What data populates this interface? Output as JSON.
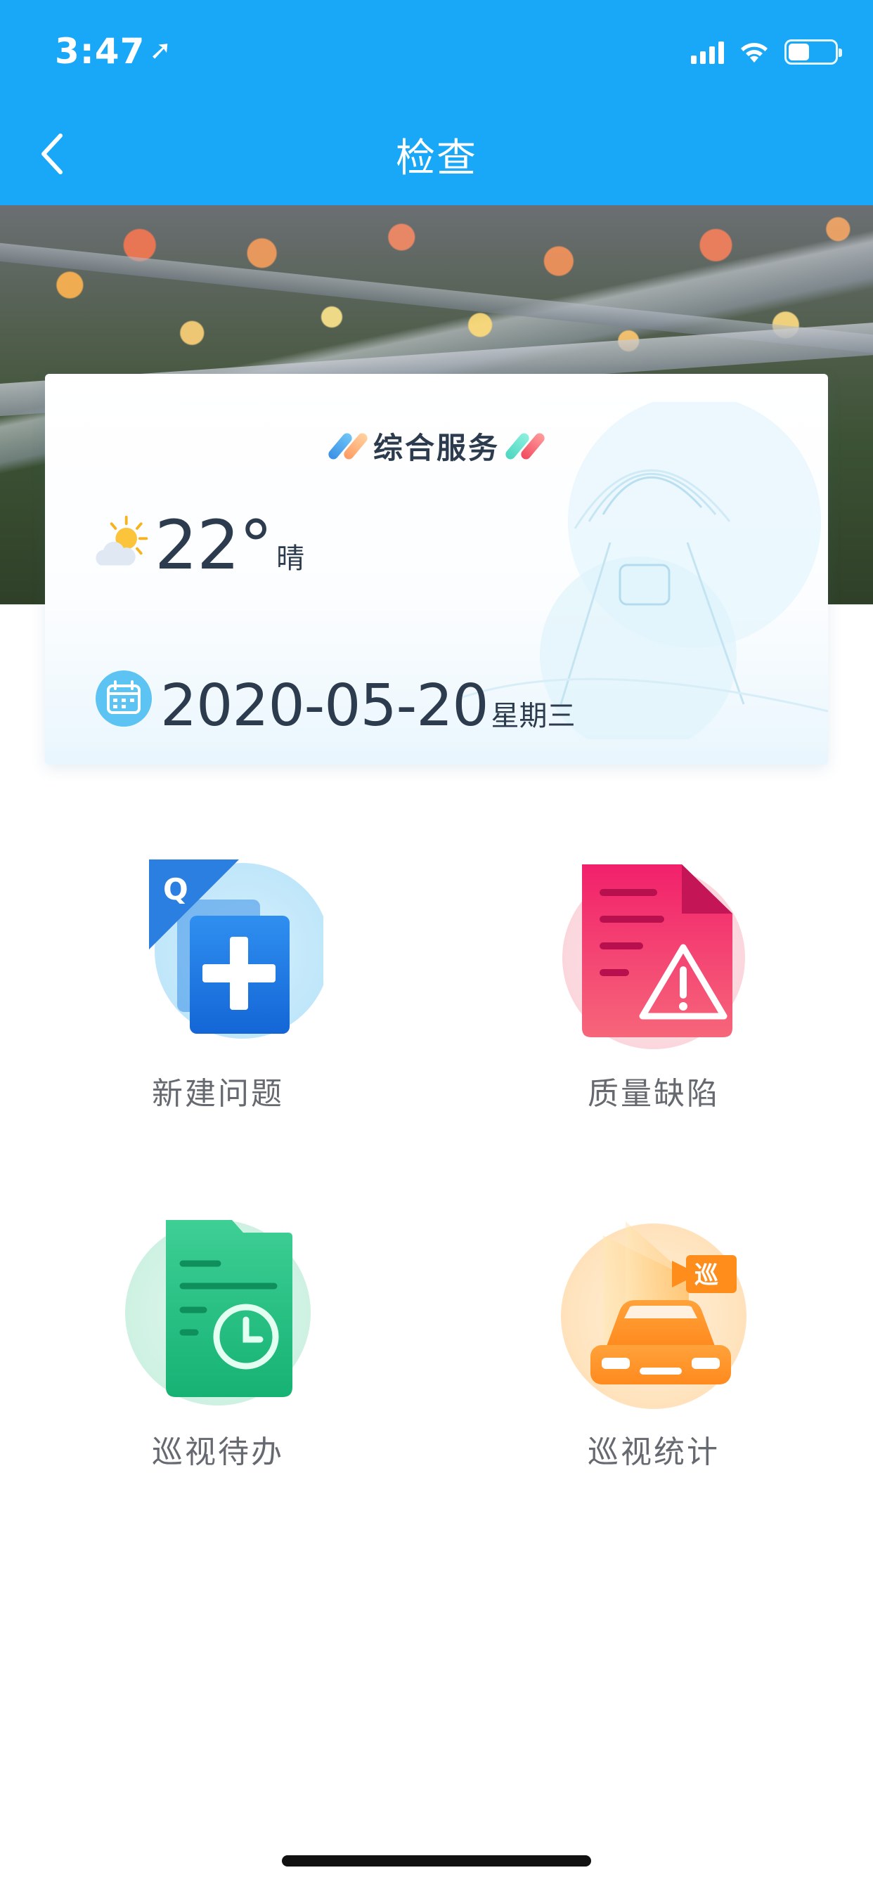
{
  "status_bar": {
    "time": "3:47",
    "battery_level": 0.45
  },
  "nav": {
    "title": "检查"
  },
  "service_card": {
    "title": "综合服务",
    "temperature": "22°",
    "weather": "晴",
    "date": "2020-05-20",
    "weekday": "星期三"
  },
  "grid": {
    "items": [
      {
        "label": "新建问题",
        "icon": "new-issue-icon"
      },
      {
        "label": "质量缺陷",
        "icon": "quality-defect-icon"
      },
      {
        "label": "巡视待办",
        "icon": "patrol-todo-icon"
      },
      {
        "label": "巡视统计",
        "icon": "patrol-stats-icon"
      }
    ]
  },
  "colors": {
    "header": "#19a8f7",
    "text_dark": "#2c3b4d",
    "label": "#666a70"
  }
}
